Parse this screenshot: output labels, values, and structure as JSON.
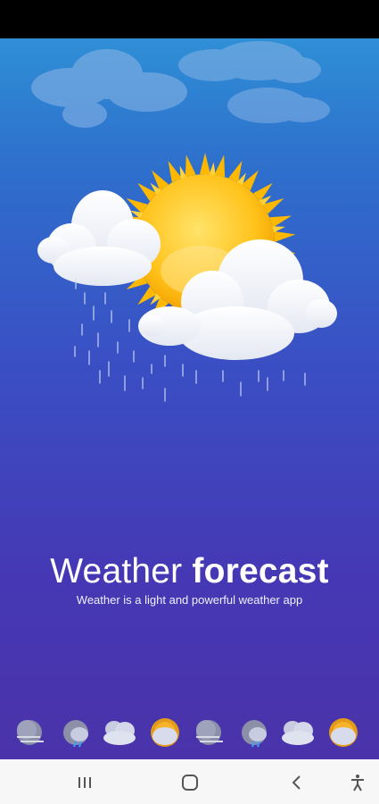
{
  "app": {
    "title_light": "Weather",
    "title_bold": "forecast",
    "subtitle": "Weather is a light and powerful weather app"
  },
  "weather_icons": [
    "fog-night-icon",
    "rain-night-icon",
    "cloudy-icon",
    "sun-cloud-icon",
    "fog-night-icon",
    "rain-night-icon",
    "cloudy-icon",
    "sun-cloud-icon"
  ],
  "navigation": {
    "buttons": [
      "recent-apps-icon",
      "home-icon",
      "back-icon",
      "accessibility-icon"
    ]
  },
  "colors": {
    "sky_top": "#2f8fd6",
    "sky_bottom": "#4a33aa",
    "sun": "#ffc21a",
    "cloud": "#ffffff",
    "nav_bar": "#f7f7f7"
  }
}
